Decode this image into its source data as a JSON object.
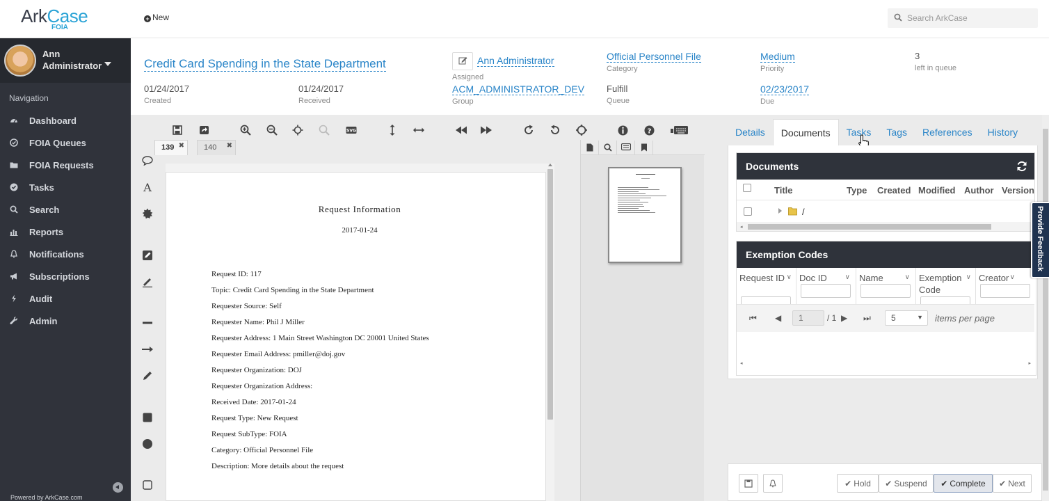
{
  "app": {
    "logo_ark": "Ark",
    "logo_case": "Case",
    "logo_sub": "FOIA",
    "new_label": "New",
    "search_placeholder": "Search ArkCase",
    "powered_by": "Powered by ArkCase.com"
  },
  "user": {
    "first": "Ann",
    "last": "Administrator"
  },
  "sidebar": {
    "title": "Navigation",
    "items": [
      {
        "label": "Dashboard",
        "icon": "dashboard-icon"
      },
      {
        "label": "FOIA Queues",
        "icon": "check-circle-icon"
      },
      {
        "label": "FOIA Requests",
        "icon": "folder-icon"
      },
      {
        "label": "Tasks",
        "icon": "check-circle-icon"
      },
      {
        "label": "Search",
        "icon": "search-icon"
      },
      {
        "label": "Reports",
        "icon": "bar-chart-icon"
      },
      {
        "label": "Notifications",
        "icon": "bell-icon"
      },
      {
        "label": "Subscriptions",
        "icon": "bullhorn-icon"
      },
      {
        "label": "Audit",
        "icon": "bolt-icon"
      },
      {
        "label": "Admin",
        "icon": "wrench-icon"
      }
    ]
  },
  "header": {
    "title": "Credit Card Spending in the State Department",
    "created_value": "01/24/2017",
    "created_label": "Created",
    "received_value": "01/24/2017",
    "received_label": "Received",
    "assigned_value": "Ann Administrator",
    "assigned_label": "Assigned",
    "group_value": "ACM_ADMINISTRATOR_DEV",
    "group_label": "Group",
    "category_value": "Official Personnel File",
    "category_label": "Category",
    "queue_value": "Fulfill",
    "queue_label": "Queue",
    "priority_value": "Medium",
    "priority_label": "Priority",
    "due_value": "02/23/2017",
    "due_label": "Due",
    "left_value": "3",
    "left_label": "left in queue"
  },
  "viewer": {
    "tabs": [
      {
        "label": "139"
      },
      {
        "label": "140"
      }
    ],
    "close_glyph": "✖",
    "doc": {
      "title": "Request Information",
      "date": "2017-01-24",
      "lines": [
        "Request ID: 117",
        "Topic: Credit Card Spending in the State Department",
        "Requester Source: Self",
        "Requester Name: Phil J Miller",
        "Requester Address: 1 Main Street Washington DC 20001 United States",
        "Requester Email Address: pmiller@doj.gov",
        "Requester Organization: DOJ",
        "Requester Organization Address:",
        "Received Date: 2017-01-24",
        "Request Type: New Request",
        "Request SubType: FOIA",
        "Category: Official Personnel File",
        "Description: More details about the request"
      ]
    }
  },
  "right": {
    "tabs": [
      "Details",
      "Documents",
      "Tasks",
      "Tags",
      "References",
      "History"
    ],
    "active_tab": "Documents",
    "documents": {
      "title": "Documents",
      "columns": [
        "Title",
        "Type",
        "Created",
        "Modified",
        "Author",
        "Version"
      ],
      "root": "/"
    },
    "exemptions": {
      "title": "Exemption Codes",
      "columns": [
        "Request ID",
        "Doc ID",
        "Name",
        "Exemption",
        "Code",
        "Creator"
      ],
      "page_value": "1",
      "page_total": "/ 1",
      "per_page": "5",
      "per_page_label": "items per page"
    }
  },
  "actions": {
    "hold": "Hold",
    "suspend": "Suspend",
    "complete": "Complete",
    "next": "Next"
  },
  "feedback": "Provide Feedback",
  "colors": {
    "sidebar": "#30333b",
    "link": "#2a85c8",
    "panel_header": "#2f333b",
    "accent": "#2aa3d6"
  }
}
